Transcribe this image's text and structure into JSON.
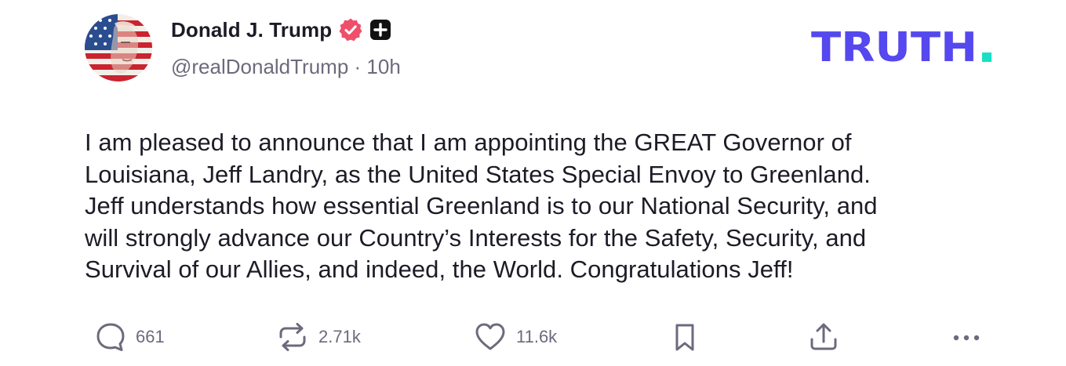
{
  "post": {
    "author": {
      "display_name": "Donald J. Trump",
      "handle": "@realDonaldTrump",
      "separator": " · ",
      "age": "10h",
      "verified_icon": "verified-badge-icon",
      "plus_icon": "plus-square-icon"
    },
    "brand": {
      "wordmark": "TRUTH",
      "dot": ".",
      "wordmark_color": "#5448ee",
      "dot_color": "#17e0c5"
    },
    "text": "I am pleased to announce that I am appointing the GREAT Governor of\nLouisiana, Jeff Landry, as the United States Special Envoy to Greenland.\nJeff understands how essential Greenland is to our National Security, and\nwill strongly advance our Country’s Interests for the Safety, Security, and\nSurvival of our Allies, and indeed, the World. Congratulations Jeff!",
    "actions": {
      "replies": {
        "icon": "comment-icon",
        "count": "661"
      },
      "retruths": {
        "icon": "repost-icon",
        "count": "2.71k"
      },
      "likes": {
        "icon": "heart-icon",
        "count": "11.6k"
      },
      "bookmark": {
        "icon": "bookmark-icon"
      },
      "share": {
        "icon": "share-icon"
      },
      "more": {
        "icon": "more-icon"
      }
    },
    "colors": {
      "text": "#1d1b26",
      "muted": "#6d6a7c",
      "verified": "#ef4f6b",
      "icon": "#6d6a7c"
    }
  }
}
